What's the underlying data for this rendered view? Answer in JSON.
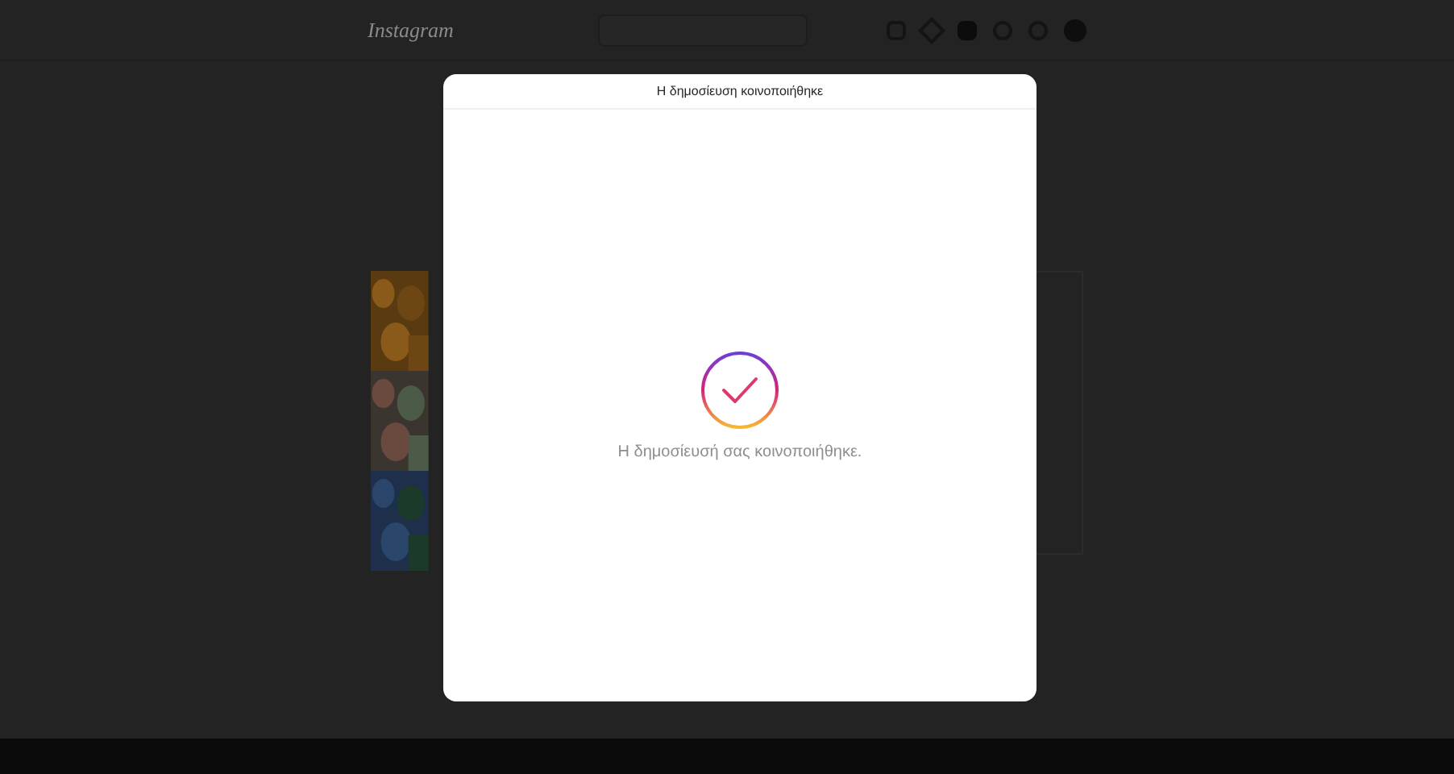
{
  "nav": {
    "logo": "Instagram"
  },
  "dialog": {
    "title": "Η δημοσίευση κοινοποιήθηκε",
    "message": "Η δημοσίευσή σας κοινοποιήθηκε."
  }
}
